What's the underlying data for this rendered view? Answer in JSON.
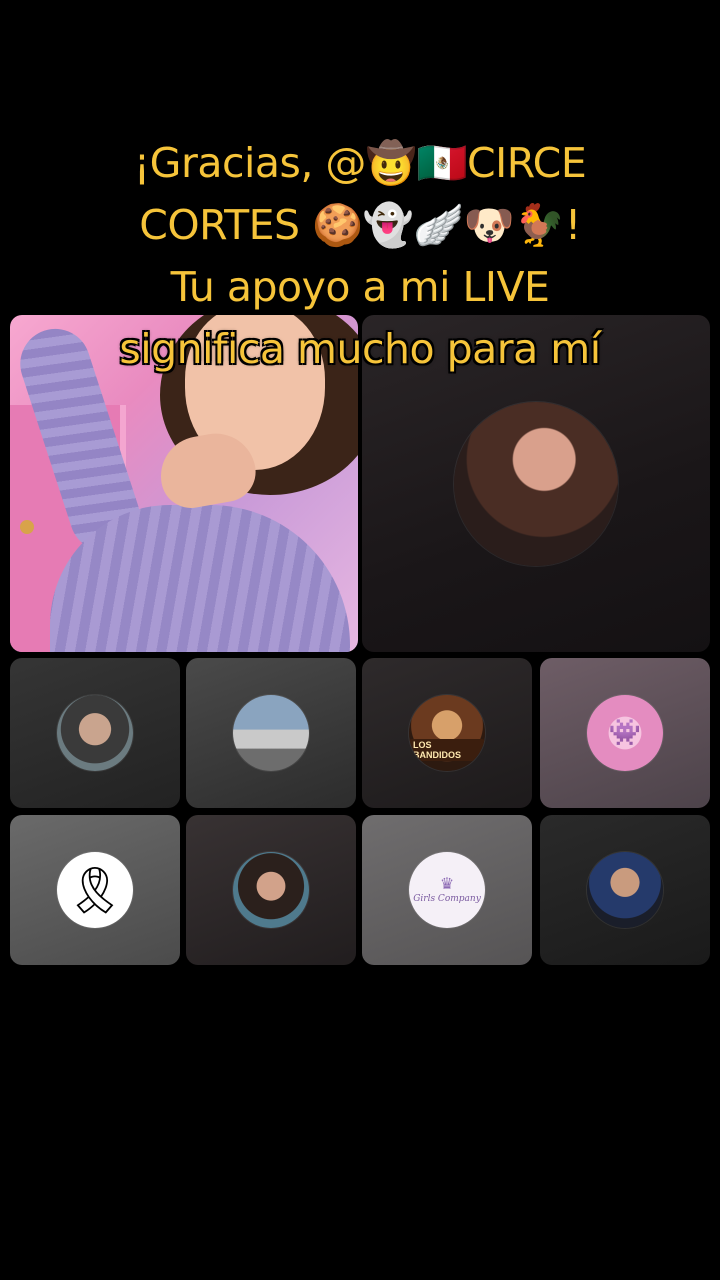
{
  "caption": {
    "line1": "¡Gracias, @🤠🇲🇽CIRCE",
    "line2": "CORTES 🍪👻🪽🐶🐓!",
    "line3": "Tu apoyo a mi LIVE",
    "line4": "significa mucho para mí"
  },
  "guests": [
    {
      "icon": "man-portrait"
    },
    {
      "icon": "white-pickup-truck"
    },
    {
      "icon": "los-bandidos-badge",
      "label": "LOS BANDIDOS"
    },
    {
      "icon": "stitch-pink-avatar",
      "glyph": "👾"
    },
    {
      "icon": "black-mourning-ribbon",
      "glyph": "🎗"
    },
    {
      "icon": "woman-portrait"
    },
    {
      "icon": "girls-company-logo",
      "glyph": "♛",
      "label": "Girls Company"
    },
    {
      "icon": "man-blue-shirt-portrait"
    }
  ],
  "colors": {
    "caption_text": "#f6c43a",
    "background": "#000000"
  }
}
